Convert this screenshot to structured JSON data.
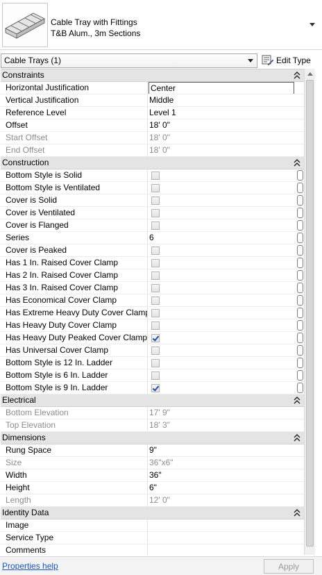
{
  "type_selector": {
    "line1": "Cable Tray with Fittings",
    "line2": "T&B Alum., 3m Sections"
  },
  "instance_filter": {
    "value": "Cable Trays (1)"
  },
  "edit_type_label": "Edit Type",
  "sections": {
    "constraints": {
      "title": "Constraints",
      "rows": [
        {
          "name": "Horizontal Justification",
          "value": "Center"
        },
        {
          "name": "Vertical Justification",
          "value": "Middle"
        },
        {
          "name": "Reference Level",
          "value": "Level 1"
        },
        {
          "name": "Offset",
          "value": "18'  0\""
        },
        {
          "name": "Start Offset",
          "value": "18'  0\""
        },
        {
          "name": "End Offset",
          "value": "18'  0\""
        }
      ]
    },
    "construction": {
      "title": "Construction",
      "rows": [
        {
          "name": "Bottom Style is Solid",
          "checked": false
        },
        {
          "name": "Bottom Style is Ventilated",
          "checked": false
        },
        {
          "name": "Cover is Solid",
          "checked": false
        },
        {
          "name": "Cover is Ventilated",
          "checked": false
        },
        {
          "name": "Cover is Flanged",
          "checked": false
        },
        {
          "name": "Series",
          "value": "6"
        },
        {
          "name": "Cover is Peaked",
          "checked": false
        },
        {
          "name": "Has 1 In. Raised Cover Clamp",
          "checked": false
        },
        {
          "name": "Has 2 In. Raised Cover Clamp",
          "checked": false
        },
        {
          "name": "Has 3 In. Raised Cover Clamp",
          "checked": false
        },
        {
          "name": "Has Economical Cover Clamp",
          "checked": false
        },
        {
          "name": "Has Extreme Heavy Duty Cover Clamp",
          "checked": false
        },
        {
          "name": "Has Heavy Duty Cover Clamp",
          "checked": false
        },
        {
          "name": "Has Heavy Duty Peaked Cover Clamp",
          "checked": true
        },
        {
          "name": "Has Universal Cover Clamp",
          "checked": false
        },
        {
          "name": "Bottom Style is 12 In. Ladder",
          "checked": false
        },
        {
          "name": "Bottom Style is 6 In. Ladder",
          "checked": false
        },
        {
          "name": "Bottom Style is 9 In. Ladder",
          "checked": true
        }
      ]
    },
    "electrical": {
      "title": "Electrical",
      "rows": [
        {
          "name": "Bottom Elevation",
          "value": "17'  9\""
        },
        {
          "name": "Top Elevation",
          "value": "18'  3\""
        }
      ]
    },
    "dimensions": {
      "title": "Dimensions",
      "rows": [
        {
          "name": "Rung Space",
          "value": "9\""
        },
        {
          "name": "Size",
          "value": "36\"x6\""
        },
        {
          "name": "Width",
          "value": "36\""
        },
        {
          "name": "Height",
          "value": "6\""
        },
        {
          "name": "Length",
          "value": "12'  0\""
        }
      ]
    },
    "identity": {
      "title": "Identity Data",
      "rows": [
        {
          "name": "Image",
          "value": ""
        },
        {
          "name": "Service Type",
          "value": ""
        },
        {
          "name": "Comments",
          "value": ""
        }
      ]
    }
  },
  "footer": {
    "help_link": "Properties help",
    "apply_label": "Apply"
  },
  "colors": {
    "section_bg": "#e4e4e4",
    "disabled_text": "#8c8c8c",
    "link": "#1a56b8"
  }
}
